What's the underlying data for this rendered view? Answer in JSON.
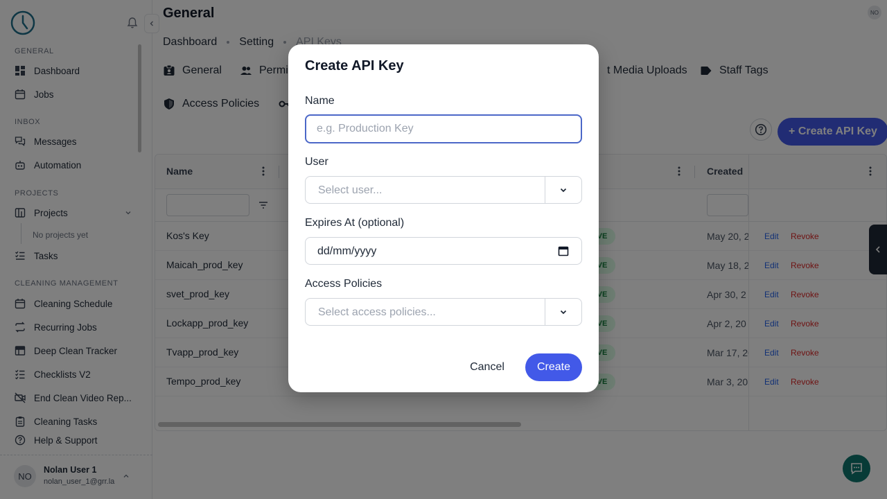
{
  "sidebar": {
    "sections": {
      "general": "GENERAL",
      "inbox": "INBOX",
      "projects": "PROJECTS",
      "cleaning": "CLEANING MANAGEMENT"
    },
    "items": {
      "dashboard": "Dashboard",
      "jobs": "Jobs",
      "messages": "Messages",
      "automation": "Automation",
      "projects": "Projects",
      "no_projects": "No projects yet",
      "tasks": "Tasks",
      "cleaning_schedule": "Cleaning Schedule",
      "recurring_jobs": "Recurring Jobs",
      "deep_clean": "Deep Clean Tracker",
      "checklists": "Checklists V2",
      "video_reports": "End Clean Video Rep...",
      "cleaning_tasks": "Cleaning Tasks",
      "help": "Help & Support"
    },
    "user": {
      "initials": "NO",
      "name": "Nolan User 1",
      "email": "nolan_user_1@grr.la"
    }
  },
  "header": {
    "title": "General",
    "avatar_initials": "NO",
    "breadcrumb": [
      "Dashboard",
      "Setting",
      "API Keys"
    ]
  },
  "tabs": {
    "general": "General",
    "permissions": "Permi",
    "media": "t Media Uploads",
    "staff_tags": "Staff Tags",
    "access_policies": "Access Policies"
  },
  "toolbar": {
    "create_label": "+ Create API Key"
  },
  "table": {
    "headers": {
      "name": "Name",
      "created": "Created"
    },
    "status_label": "VE",
    "rows": [
      {
        "name": "Kos's Key",
        "date": "May 20, 2",
        "edit": "Edit",
        "revoke": "Revoke"
      },
      {
        "name": "Maicah_prod_key",
        "date": "May 18, 2",
        "edit": "Edit",
        "revoke": "Revoke"
      },
      {
        "name": "svet_prod_key",
        "date": "Apr 30, 2",
        "edit": "Edit",
        "revoke": "Revoke"
      },
      {
        "name": "Lockapp_prod_key",
        "date": "Apr 2, 20",
        "edit": "Edit",
        "revoke": "Revoke"
      },
      {
        "name": "Tvapp_prod_key",
        "date": "Mar 17, 20",
        "edit": "Edit",
        "revoke": "Revoke"
      },
      {
        "name": "Tempo_prod_key",
        "date": "Mar 3, 20",
        "edit": "Edit",
        "revoke": "Revoke"
      }
    ]
  },
  "modal": {
    "title": "Create API Key",
    "name_label": "Name",
    "name_placeholder": "e.g. Production Key",
    "name_value": "",
    "user_label": "User",
    "user_placeholder": "Select user...",
    "expires_label": "Expires At (optional)",
    "expires_placeholder": "dd/mm/yyyy",
    "policies_label": "Access Policies",
    "policies_placeholder": "Select access policies...",
    "cancel_label": "Cancel",
    "create_label": "Create"
  },
  "colors": {
    "primary": "#4259e8",
    "focus_border": "#4b67c8",
    "revoke": "#dc2626",
    "edit": "#2563eb",
    "chat_fab": "#0f766e"
  }
}
